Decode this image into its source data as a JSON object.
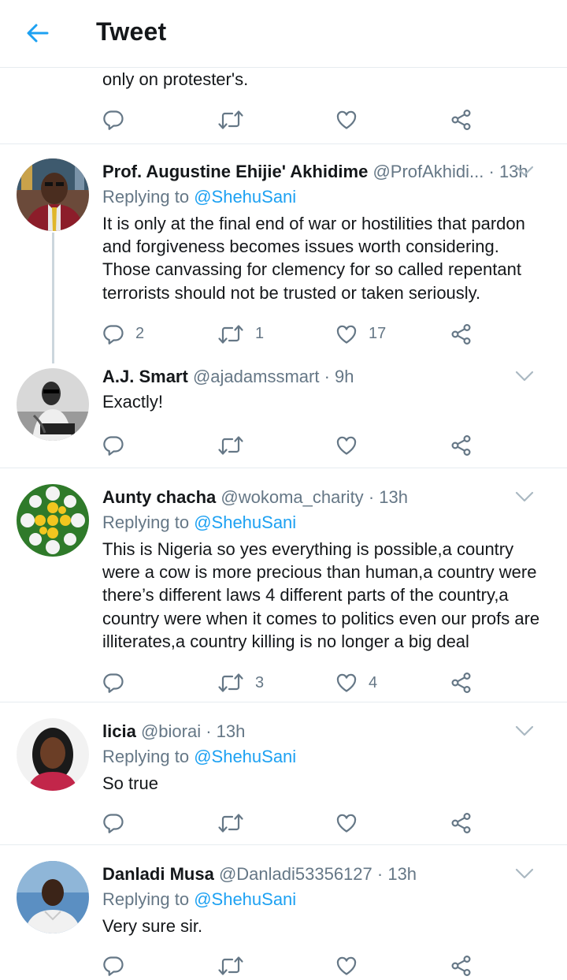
{
  "header": {
    "title": "Tweet",
    "back_icon": "arrow-left-icon",
    "accent": "#1da1f2"
  },
  "prev_tweet": {
    "text": "only on protester's."
  },
  "tweets": [
    {
      "name": "Prof. Augustine Ehijie' Akhidime",
      "handle": "@ProfAkhidi...",
      "time": "· 13h",
      "replying_prefix": "Replying to",
      "replying_to": "@ShehuSani",
      "text": "It is only at the final end of war or hostilities that pardon and forgiveness becomes issues worth considering. Those canvassing for clemency for so called repentant terrorists should not be trusted or taken seriously.",
      "replies": "2",
      "retweets": "1",
      "likes": "17"
    },
    {
      "name": "A.J. Smart",
      "handle": "@ajadamssmart",
      "time": "· 9h",
      "text": "Exactly!",
      "replies": "",
      "retweets": "",
      "likes": ""
    },
    {
      "name": "Aunty chacha",
      "handle": "@wokoma_charity",
      "time": "· 13h",
      "replying_prefix": "Replying to",
      "replying_to": "@ShehuSani",
      "text": "This is Nigeria so yes everything is possible,a country were a cow is more precious than human,a country were there’s different laws 4 different parts of the country,a country were when it comes to politics even our profs are illiterates,a country killing is no longer a big deal",
      "replies": "",
      "retweets": "3",
      "likes": "4"
    },
    {
      "name": "licia",
      "handle": "@biorai",
      "time": "· 13h",
      "replying_prefix": "Replying to",
      "replying_to": "@ShehuSani",
      "text": "So true",
      "replies": "",
      "retweets": "",
      "likes": ""
    },
    {
      "name": "Danladi Musa",
      "handle": "@Danladi53356127",
      "time": "· 13h",
      "replying_prefix": "Replying to",
      "replying_to": "@ShehuSani",
      "text": "Very sure sir.",
      "replies": "",
      "retweets": "",
      "likes": ""
    }
  ]
}
